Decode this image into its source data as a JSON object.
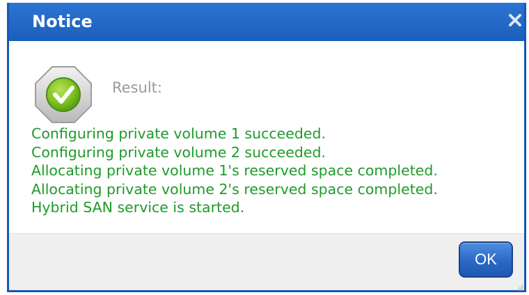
{
  "dialog": {
    "title": "Notice",
    "close_icon": "close-icon",
    "status_icon": "success-check-icon",
    "result_label": "Result:",
    "messages": [
      "Configuring private volume 1 succeeded.",
      "Configuring private volume 2 succeeded.",
      "Allocating private volume 1's reserved space completed.",
      "Allocating private volume 2's reserved space completed.",
      "Hybrid SAN service is started."
    ],
    "ok_label": "OK"
  },
  "colors": {
    "titlebar": "#1a5fba",
    "message_text": "#1f9a2a",
    "result_label": "#9a9a9a",
    "ok_button": "#2b68c6"
  }
}
